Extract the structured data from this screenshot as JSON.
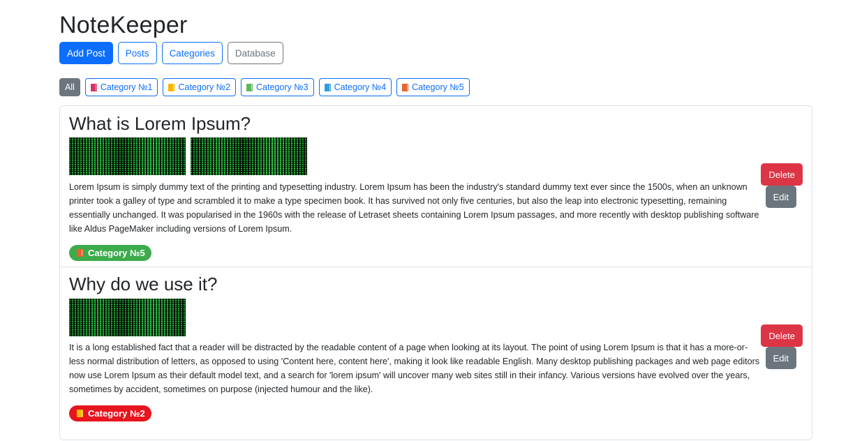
{
  "app": {
    "title": "NoteKeeper"
  },
  "nav": {
    "add_post": "Add Post",
    "posts": "Posts",
    "categories": "Categories",
    "database": "Database"
  },
  "filters": {
    "all": "All",
    "items": [
      {
        "label": "Category №1",
        "icon": "red-book-icon",
        "color": "#d6336c"
      },
      {
        "label": "Category №2",
        "icon": "yellow-book-icon",
        "color": "#f5b800"
      },
      {
        "label": "Category №3",
        "icon": "green-book-icon",
        "color": "#5cb85c"
      },
      {
        "label": "Category №4",
        "icon": "blue-book-icon",
        "color": "#2d9ee0"
      },
      {
        "label": "Category №5",
        "icon": "orange-book-icon",
        "color": "#e8622c"
      }
    ]
  },
  "posts": [
    {
      "title": "What is Lorem Ipsum?",
      "images": [
        "matrix-code-image",
        "matrix-code-image"
      ],
      "body": "Lorem Ipsum is simply dummy text of the printing and typesetting industry. Lorem Ipsum has been the industry's standard dummy text ever since the 1500s, when an unknown printer took a galley of type and scrambled it to make a type specimen book. It has survived not only five centuries, but also the leap into electronic typesetting, remaining essentially unchanged. It was popularised in the 1960s with the release of Letraset sheets containing Lorem Ipsum passages, and more recently with desktop publishing software like Aldus PageMaker including versions of Lorem Ipsum.",
      "category": "Category №5",
      "category_color": "#3cab4b",
      "category_icon_color": "#e8622c",
      "delete_label": "Delete",
      "edit_label": "Edit"
    },
    {
      "title": "Why do we use it?",
      "images": [
        "matrix-code-image"
      ],
      "body": "It is a long established fact that a reader will be distracted by the readable content of a page when looking at its layout. The point of using Lorem Ipsum is that it has a more-or-less normal distribution of letters, as opposed to using 'Content here, content here', making it look like readable English. Many desktop publishing packages and web page editors now use Lorem Ipsum as their default model text, and a search for 'lorem ipsum' will uncover many web sites still in their infancy. Various versions have evolved over the years, sometimes by accident, sometimes on purpose (injected humour and the like).",
      "category": "Category №2",
      "category_color": "#e8141e",
      "category_icon_color": "#f5b800",
      "delete_label": "Delete",
      "edit_label": "Edit"
    }
  ],
  "colors": {
    "primary": "#0d6efd",
    "secondary": "#6c757d",
    "danger": "#dc3545"
  }
}
